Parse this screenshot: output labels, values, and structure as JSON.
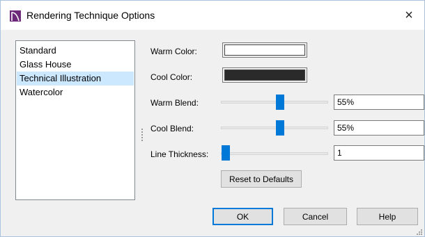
{
  "window": {
    "title": "Rendering Technique Options",
    "close_glyph": "×",
    "accent": "#0078d7"
  },
  "technique_list": {
    "items": [
      "Standard",
      "Glass House",
      "Technical Illustration",
      "Watercolor"
    ],
    "selected": "Technical Illustration",
    "selected_bg": "#cce8ff"
  },
  "settings": {
    "warm_color": {
      "label": "Warm Color:",
      "swatch_color": "#ffffff"
    },
    "cool_color": {
      "label": "Cool Color:",
      "swatch_color": "#2a2a2a"
    },
    "warm_blend": {
      "label": "Warm Blend:",
      "value": "55%",
      "level_percent": 55
    },
    "cool_blend": {
      "label": "Cool Blend:",
      "value": "55%",
      "level_percent": 55
    },
    "line_thickness": {
      "label": "Line Thickness:",
      "value": "1",
      "level_percent": 0
    },
    "reset_label": "Reset to Defaults"
  },
  "footer": {
    "ok_label": "OK",
    "cancel_label": "Cancel",
    "help_label": "Help"
  }
}
